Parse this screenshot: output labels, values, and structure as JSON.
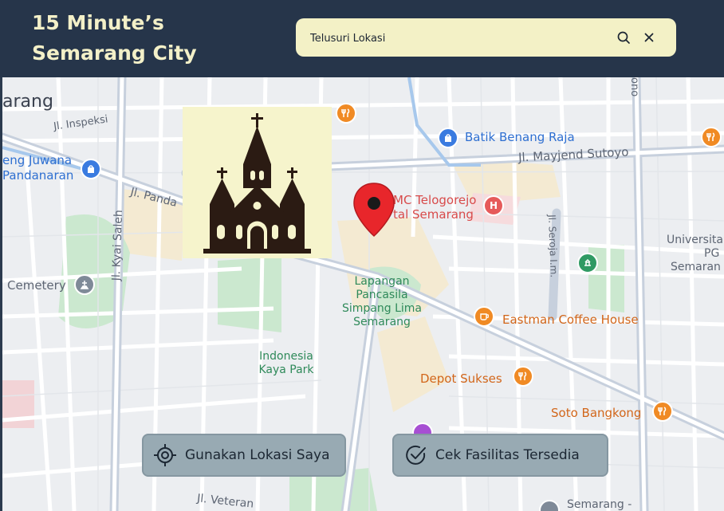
{
  "header": {
    "title_line1": "15 Minute’s",
    "title_line2": "Semarang City"
  },
  "search": {
    "placeholder": "Telusuri Lokasi",
    "search_icon": "search-icon",
    "clear_icon": "close-icon"
  },
  "map": {
    "labels": {
      "arang": "arang",
      "jl_inspeksi": "Jl. Inspeksi",
      "eng_juwana": "eng Juwana",
      "pandanaran": "Pandanaran",
      "jl_pandanaran": "Jl. Panda",
      "jl_kyai_saleh": "Jl. Kyai Saleh",
      "cemetery": "Cemetery",
      "batik": "Batik Benang Raja",
      "jl_mayjend": "Jl. Mayjend Sutoyo",
      "smc_1": "MC Telogorejo",
      "smc_2": "tal Semarang",
      "jl_seroja": "Jl. Seroja I.m.",
      "ono": "ono",
      "universitas_1": "Universita",
      "universitas_2": "PG",
      "universitas_3": "Semaran",
      "lapangan_1": "Lapangan",
      "lapangan_2": "Pancasila",
      "lapangan_3": "Simpang Lima",
      "lapangan_4": "Semarang",
      "eastman": "Eastman Coffee House",
      "indonesia_1": "Indonesia",
      "indonesia_2": "Kaya Park",
      "depot": "Depot Sukses",
      "soto": "Soto Bangkong",
      "jl_veteran": "Jl. Veteran",
      "semarang_bottom": "Semarang -"
    },
    "selected_place_icon": "church-icon",
    "location_marker": "map-pin-icon"
  },
  "actions": {
    "use_location": "Gunakan Lokasi Saya",
    "check_facilities": "Cek Fasilitas Tersedia"
  },
  "colors": {
    "header_bg": "#26354a",
    "title": "#f3f0c8",
    "search_bg": "#f3f1c6",
    "button_bg": "#98aab3",
    "pin_red": "#e8262b"
  }
}
